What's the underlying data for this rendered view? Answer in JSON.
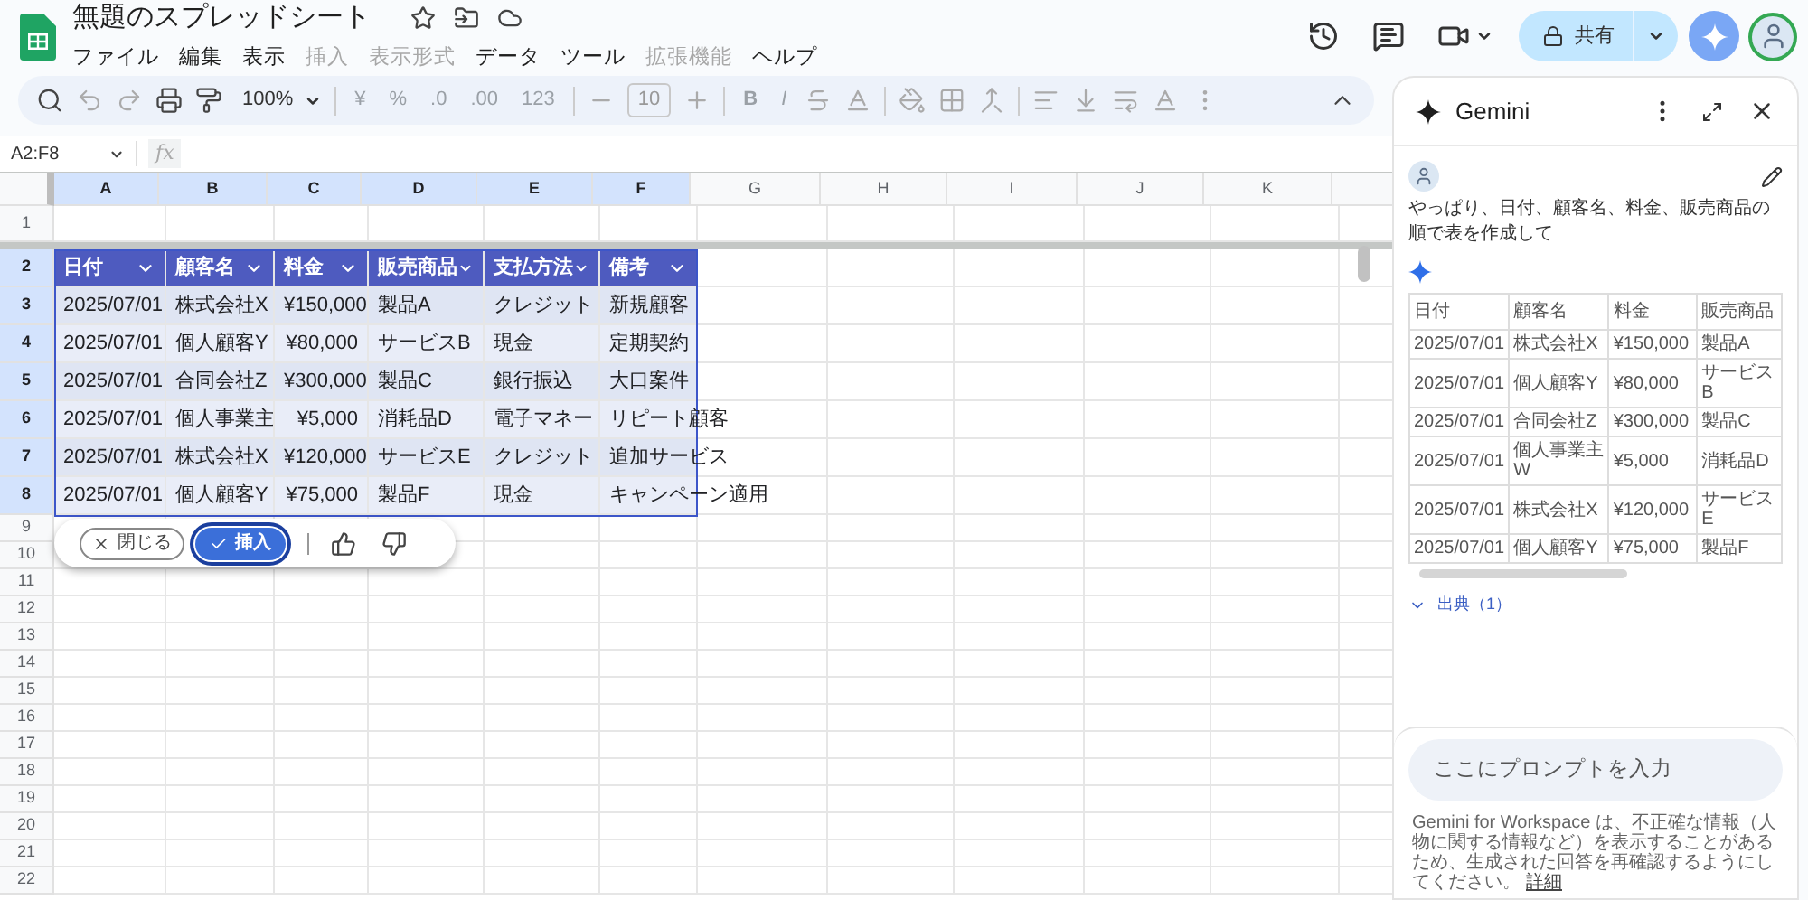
{
  "doc": {
    "title": "無題のスプレッドシート"
  },
  "menus": [
    {
      "label": "ファイル",
      "disabled": false
    },
    {
      "label": "編集",
      "disabled": false
    },
    {
      "label": "表示",
      "disabled": false
    },
    {
      "label": "挿入",
      "disabled": true
    },
    {
      "label": "表示形式",
      "disabled": true
    },
    {
      "label": "データ",
      "disabled": false
    },
    {
      "label": "ツール",
      "disabled": false
    },
    {
      "label": "拡張機能",
      "disabled": true
    },
    {
      "label": "ヘルプ",
      "disabled": false
    }
  ],
  "share": {
    "label": "共有"
  },
  "toolbar": {
    "zoom": "100%",
    "currency": "¥",
    "percent": "%",
    "decimal_decrease": ".0",
    "decimal_increase": ".00",
    "number_format": "123",
    "font_size": "10",
    "bold": "B",
    "italic": "I"
  },
  "name_box": "A2:F8",
  "formula_label": "fx",
  "columns": [
    {
      "label": "A",
      "selected": true
    },
    {
      "label": "B",
      "selected": true
    },
    {
      "label": "C",
      "selected": true
    },
    {
      "label": "D",
      "selected": true
    },
    {
      "label": "E",
      "selected": true
    },
    {
      "label": "F",
      "selected": true
    },
    {
      "label": "G",
      "selected": false
    },
    {
      "label": "H",
      "selected": false
    },
    {
      "label": "I",
      "selected": false
    },
    {
      "label": "J",
      "selected": false
    },
    {
      "label": "K",
      "selected": false
    }
  ],
  "row_numbers": [
    {
      "label": "1",
      "selected": false
    },
    {
      "label": "2",
      "selected": true
    },
    {
      "label": "3",
      "selected": true
    },
    {
      "label": "4",
      "selected": true
    },
    {
      "label": "5",
      "selected": true
    },
    {
      "label": "6",
      "selected": true
    },
    {
      "label": "7",
      "selected": true
    },
    {
      "label": "8",
      "selected": true
    },
    {
      "label": "9",
      "selected": false
    },
    {
      "label": "10",
      "selected": false
    },
    {
      "label": "11",
      "selected": false
    },
    {
      "label": "12",
      "selected": false
    },
    {
      "label": "13",
      "selected": false
    },
    {
      "label": "14",
      "selected": false
    },
    {
      "label": "15",
      "selected": false
    },
    {
      "label": "16",
      "selected": false
    },
    {
      "label": "17",
      "selected": false
    },
    {
      "label": "18",
      "selected": false
    },
    {
      "label": "19",
      "selected": false
    },
    {
      "label": "20",
      "selected": false
    },
    {
      "label": "21",
      "selected": false
    },
    {
      "label": "22",
      "selected": false
    }
  ],
  "sheet_table": {
    "header": [
      "日付",
      "顧客名",
      "料金",
      "販売商品",
      "支払方法",
      "備考"
    ],
    "rows": [
      [
        "2025/07/01",
        "株式会社X",
        "¥150,000",
        "製品A",
        "クレジット",
        "新規顧客"
      ],
      [
        "2025/07/01",
        "個人顧客Y",
        "¥80,000",
        "サービスB",
        "現金",
        "定期契約"
      ],
      [
        "2025/07/01",
        "合同会社Z",
        "¥300,000",
        "製品C",
        "銀行振込",
        "大口案件"
      ],
      [
        "2025/07/01",
        "個人事業主",
        "¥5,000",
        "消耗品D",
        "電子マネー",
        "リピート顧客"
      ],
      [
        "2025/07/01",
        "株式会社X",
        "¥120,000",
        "サービスE",
        "クレジット",
        "追加サービス"
      ],
      [
        "2025/07/01",
        "個人顧客Y",
        "¥75,000",
        "製品F",
        "現金",
        "キャンペーン適用"
      ]
    ]
  },
  "suggestion_bar": {
    "close": "閉じる",
    "insert": "挿入"
  },
  "gemini": {
    "title": "Gemini",
    "user_message": "やっぱり、日付、顧客名、料金、販売商品の順で表を作成して",
    "table": {
      "header": [
        "日付",
        "顧客名",
        "料金",
        "販売商品"
      ],
      "rows": [
        [
          "2025/07/01",
          "株式会社X",
          "¥150,000",
          "製品A"
        ],
        [
          "2025/07/01",
          "個人顧客Y",
          "¥80,000",
          "サービスB"
        ],
        [
          "2025/07/01",
          "合同会社Z",
          "¥300,000",
          "製品C"
        ],
        [
          "2025/07/01",
          "個人事業主W",
          "¥5,000",
          "消耗品D"
        ],
        [
          "2025/07/01",
          "株式会社X",
          "¥120,000",
          "サービスE"
        ],
        [
          "2025/07/01",
          "個人顧客Y",
          "¥75,000",
          "製品F"
        ]
      ]
    },
    "sources": {
      "label": "出典（1）",
      "expanded": false
    },
    "prompt": {
      "placeholder": "ここにプロンプトを入力"
    },
    "disclaimer": {
      "text": "Gemini for Workspace は、不正確な情報（人物に関する情報など）を表示することがあるため、生成された回答を再確認するようにしてください。",
      "link": "詳細"
    }
  }
}
